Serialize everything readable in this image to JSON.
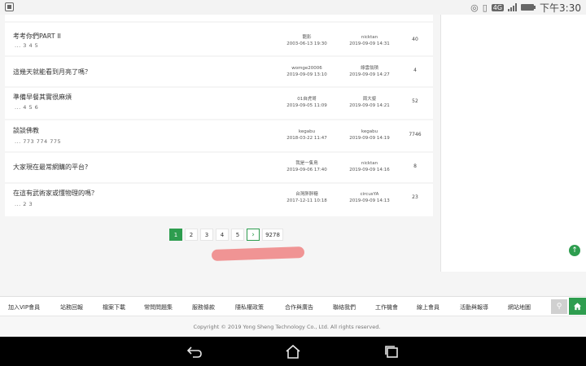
{
  "status_bar": {
    "time": "下午3:30",
    "network": "4G"
  },
  "threads": [
    {
      "title": "考考你們PART II",
      "pages": "... 3 4 5",
      "author": "龍影",
      "created": "2003-06-13 19:30",
      "last_user": "nicktan",
      "last_time": "2019-09-09 14:31",
      "replies": "40"
    },
    {
      "title": "這幾天就能看到月亮了嗎？",
      "pages": "",
      "author": "womge20006",
      "created": "2019-09-09 13:10",
      "last_user": "綠雲翁積",
      "last_time": "2019-09-09 14:27",
      "replies": "4"
    },
    {
      "title": "準備早餐其實很麻煩",
      "pages": "... 4 5 6",
      "author": "01自虎哥",
      "created": "2019-09-05 11:09",
      "last_user": "周大鋆",
      "last_time": "2019-09-09 14:21",
      "replies": "52"
    },
    {
      "title": "談談佛教",
      "pages": "... 773 774 775",
      "author": "kegabu",
      "created": "2018-03-22 11:47",
      "last_user": "kegabu",
      "last_time": "2019-09-09 14:19",
      "replies": "7746"
    },
    {
      "title": "大家現在最常網購的平台?",
      "pages": "",
      "author": "我是一隻鳥",
      "created": "2019-09-06 17:40",
      "last_user": "nicktan",
      "last_time": "2019-09-09 14:16",
      "replies": "8"
    },
    {
      "title": "在這有武術家或懂物理的嗎？",
      "pages": "... 2 3",
      "author": "台灣胖胖糖",
      "created": "2017-12-11 10:18",
      "last_user": "circusYA",
      "last_time": "2019-09-09 14:13",
      "replies": "23"
    }
  ],
  "pagination": {
    "pages": [
      "1",
      "2",
      "3",
      "4",
      "5"
    ],
    "next": "›",
    "last": "9278",
    "current": "1"
  },
  "footer_links": [
    "加入VIP會員",
    "站務回報",
    "檔案下載",
    "常問問題集",
    "服務條款",
    "隱私權政策",
    "合作與廣告",
    "聯絡我們",
    "工作機會",
    "線上會員",
    "活動與報導",
    "網站地圖"
  ],
  "copyright": "Copyright © 2019 Yong Sheng Technology Co., Ltd. All rights reserved.",
  "colors": {
    "accent": "#2e9d4f",
    "redaction": "#f08a8a"
  }
}
